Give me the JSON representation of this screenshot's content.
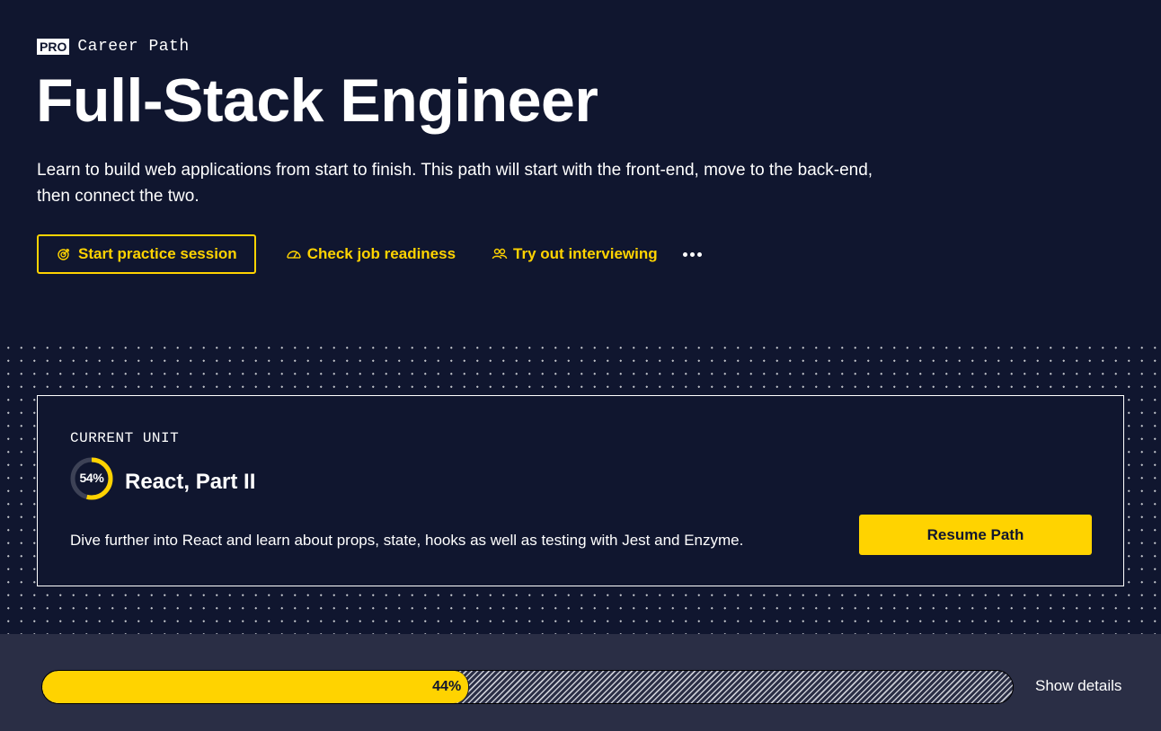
{
  "header": {
    "badge": "PRO",
    "eyebrow": "Career Path",
    "title": "Full-Stack Engineer",
    "description": "Learn to build web applications from start to finish. This path will start with the front-end, move to the back-end, then connect the two."
  },
  "actions": {
    "practice": {
      "label": "Start practice session",
      "icon": "target-icon"
    },
    "job_readiness": {
      "label": "Check job readiness",
      "icon": "gauge-icon"
    },
    "interviewing": {
      "label": "Try out interviewing",
      "icon": "people-icon"
    },
    "more_icon": "more-horizontal-icon"
  },
  "current_unit": {
    "label": "CURRENT UNIT",
    "progress_text": "54%",
    "progress": 0.54,
    "title": "React, Part II",
    "description": "Dive further into React and learn about props, state, hooks as well as testing with Jest and Enzyme.",
    "resume_label": "Resume Path"
  },
  "path_progress": {
    "progress_text": "44%",
    "progress": 0.44,
    "show_details_label": "Show details"
  },
  "colors": {
    "background": "#10162f",
    "accent": "#ffd300",
    "footer": "#2a2e45"
  }
}
